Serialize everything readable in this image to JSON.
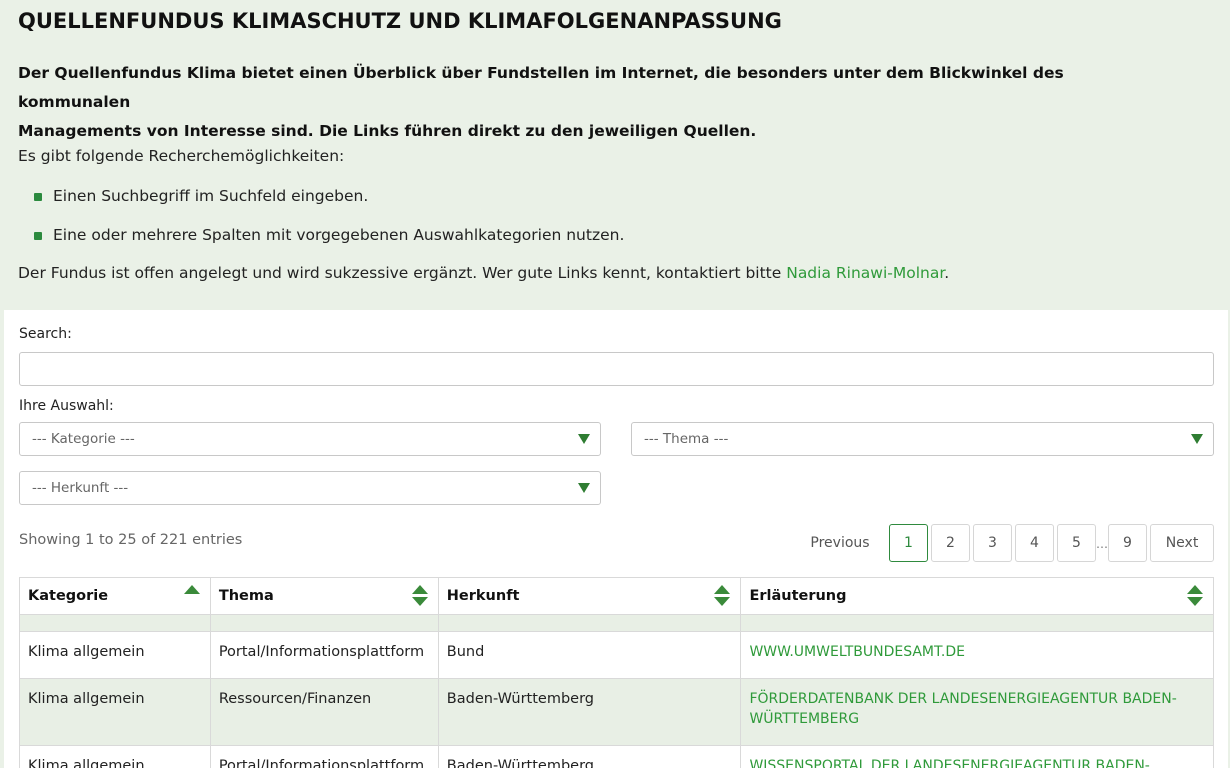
{
  "intro": {
    "title": "QUELLENFUNDUS KLIMASCHUTZ UND KLIMAFOLGENANPASSUNG",
    "lead_line1": "Der Quellenfundus Klima bietet einen Überblick über Fundstellen im Internet, die besonders unter dem Blickwinkel des kommunalen",
    "lead_line2": "Managements von Interesse sind. Die Links führen direkt zu den jeweiligen Quellen.",
    "options_intro": "Es gibt folgende Recherchemöglichkeiten:",
    "bullets": [
      "Einen Suchbegriff im Suchfeld eingeben.",
      "Eine oder mehrere Spalten mit vorgegebenen Auswahlkategorien nutzen."
    ],
    "outro_text": "Der Fundus ist offen angelegt und wird sukzessive ergänzt. Wer gute Links kennt, kontaktiert bitte ",
    "contact_link": "Nadia Rinawi-Molnar",
    "outro_end": "."
  },
  "search": {
    "label": "Search:",
    "value": ""
  },
  "filters": {
    "label": "Ihre Auswahl:",
    "kategorie": "--- Kategorie ---",
    "thema": "--- Thema ---",
    "herkunft": "--- Herkunft ---"
  },
  "table_info": "Showing 1 to 25 of 221 entries",
  "pagination": {
    "previous": "Previous",
    "pages": [
      "1",
      "2",
      "3",
      "4",
      "5",
      "9"
    ],
    "ellipsis": "…",
    "next": "Next",
    "active": "1"
  },
  "accent_color": "#2f9a3a",
  "table": {
    "headers": [
      "Kategorie",
      "Thema",
      "Herkunft",
      "Erläuterung"
    ],
    "rows": [
      {
        "kategorie": "Klima allgemein",
        "thema": "Portal/Informationsplattform",
        "herkunft": "Bund",
        "erlaeuterung": "www.umweltbundesamt.de"
      },
      {
        "kategorie": "Klima allgemein",
        "thema": "Ressourcen/Finanzen",
        "herkunft": "Baden-Württemberg",
        "erlaeuterung_line1": "Förderdatenbank der Landesenergieagentur Baden-",
        "erlaeuterung_line2": "Württemberg"
      },
      {
        "kategorie": "Klima allgemein",
        "thema": "Portal/Informationsplattform",
        "herkunft": "Baden-Württemberg",
        "erlaeuterung": "Wissensportal der Landesenergieagentur Baden-"
      }
    ]
  }
}
